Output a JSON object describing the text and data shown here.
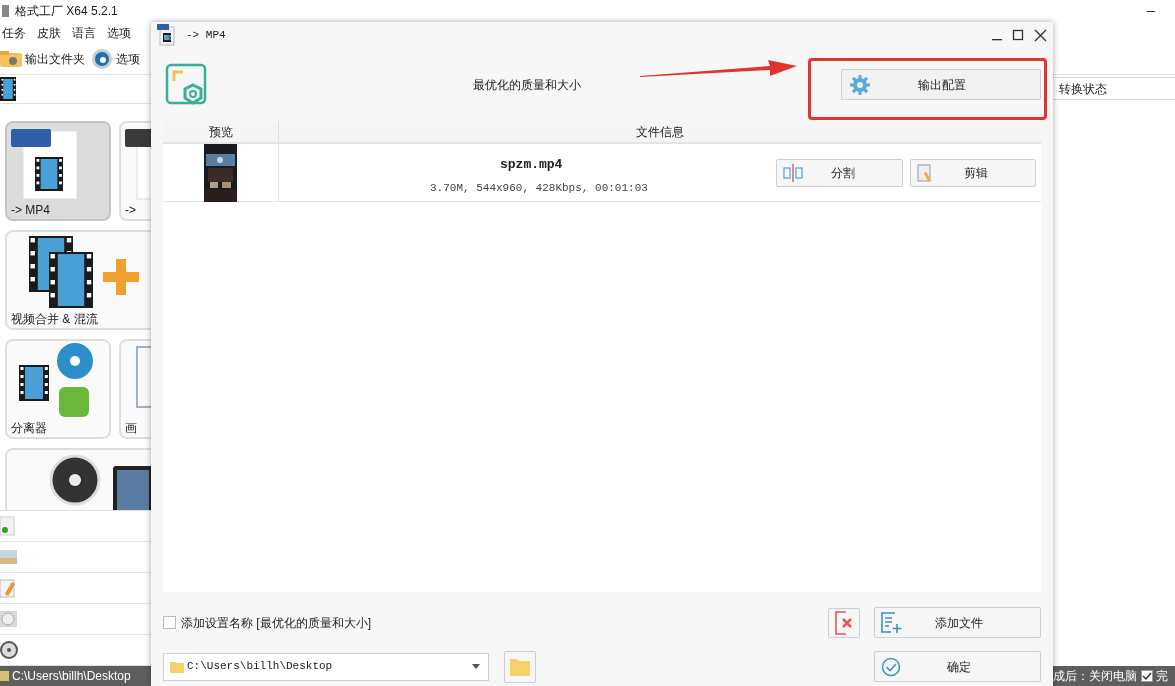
{
  "app": {
    "title": "格式工厂 X64 5.2.1",
    "menu": [
      "任务",
      "皮肤",
      "语言",
      "选项"
    ],
    "toolbar": [
      "输出文件夹",
      "选项"
    ],
    "tiles": [
      {
        "label": "-> MP4",
        "kind": "normal",
        "selected": true
      },
      {
        "label": "->",
        "kind": "normal",
        "selected": false
      },
      {
        "label": "视频合并 & 混流",
        "kind": "wide",
        "selected": false
      },
      {
        "label": "分离器",
        "kind": "normal",
        "selected": false
      },
      {
        "label": "画",
        "kind": "normal",
        "selected": false
      },
      {
        "kind": "wide",
        "selected": false
      }
    ],
    "status_column": "转换状态",
    "status_bar": {
      "path": "C:\\Users\\billh\\Desktop",
      "after_done": "成后：关闭电脑",
      "shutdown_checked": true,
      "next_label": "完"
    }
  },
  "dialog": {
    "title": "-> MP4",
    "preset": "最优化的质量和大小",
    "output_settings": "输出配置",
    "columns": [
      "预览",
      "文件信息"
    ],
    "files": [
      {
        "name": "spzm.mp4",
        "info": "3.70M, 544x960, 428Kbps, 00:01:03",
        "split": "分割",
        "edit": "剪辑"
      }
    ],
    "add_name": {
      "label": "添加设置名称 [最优化的质量和大小]",
      "checked": false
    },
    "add_file": "添加文件",
    "path": "C:\\Users\\billh\\Desktop",
    "ok": "确定"
  }
}
